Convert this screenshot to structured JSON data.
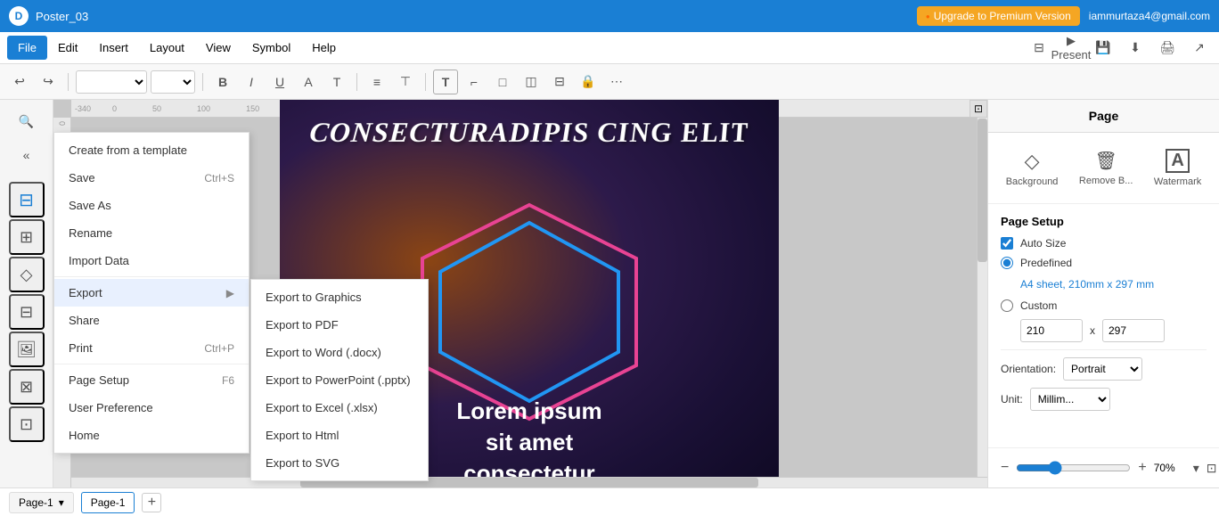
{
  "titleBar": {
    "appName": "Poster_03",
    "upgradeBtn": "Upgrade to Premium Version",
    "userEmail": "iammurtaza4@gmail.com"
  },
  "menuBar": {
    "items": [
      "File",
      "Edit",
      "Insert",
      "Layout",
      "View",
      "Symbol",
      "Help"
    ]
  },
  "toolbar": {
    "fontFamily": "",
    "fontSize": "",
    "bold": "B",
    "italic": "I",
    "underline": "U"
  },
  "fileMenu": {
    "items": [
      {
        "label": "Create from a template",
        "shortcut": "",
        "hasArrow": false
      },
      {
        "label": "Save",
        "shortcut": "Ctrl+S",
        "hasArrow": false
      },
      {
        "label": "Save As",
        "shortcut": "",
        "hasArrow": false
      },
      {
        "label": "Rename",
        "shortcut": "",
        "hasArrow": false
      },
      {
        "label": "Import Data",
        "shortcut": "",
        "hasArrow": false
      },
      {
        "label": "Export",
        "shortcut": "",
        "hasArrow": true
      },
      {
        "label": "Share",
        "shortcut": "",
        "hasArrow": false
      },
      {
        "label": "Print",
        "shortcut": "Ctrl+P",
        "hasArrow": false
      },
      {
        "label": "Page Setup",
        "shortcut": "F6",
        "hasArrow": false
      },
      {
        "label": "User Preference",
        "shortcut": "",
        "hasArrow": false
      },
      {
        "label": "Home",
        "shortcut": "",
        "hasArrow": false
      }
    ]
  },
  "exportSubmenu": {
    "items": [
      "Export to Graphics",
      "Export to PDF",
      "Export to Word (.docx)",
      "Export to PowerPoint (.pptx)",
      "Export to Excel (.xlsx)",
      "Export to Html",
      "Export to SVG"
    ]
  },
  "poster": {
    "textTop": "CONSECTURADIPIS CING ELIT",
    "textBottom": "Lorem ipsum\nsit amet\nconsectetur"
  },
  "rightPanel": {
    "title": "Page",
    "icons": [
      {
        "label": "Background",
        "glyph": "◇"
      },
      {
        "label": "Remove B...",
        "glyph": "🗑"
      },
      {
        "label": "Watermark",
        "glyph": "A"
      }
    ],
    "pageSetup": {
      "title": "Page Setup",
      "autoSize": "Auto Size",
      "predefined": "Predefined",
      "paperSize": "A4 sheet, 210mm x 297 mm",
      "custom": "Custom",
      "width": "210",
      "height": "297",
      "orientationLabel": "Orientation:",
      "orientationValue": "Portrait",
      "unitLabel": "Unit:",
      "unitValue": "Millim..."
    }
  },
  "bottomBar": {
    "pageLabel": "Page-1",
    "pageTab": "Page-1",
    "addBtn": "+"
  },
  "zoom": {
    "zoomLevel": "70%"
  },
  "sidebarIcons": [
    {
      "name": "layers-icon",
      "glyph": "❑"
    },
    {
      "name": "page-icon",
      "glyph": "⊞"
    },
    {
      "name": "shape-icon",
      "glyph": "◇"
    },
    {
      "name": "image-icon",
      "glyph": "⊟"
    },
    {
      "name": "text-icon",
      "glyph": "≡"
    },
    {
      "name": "link-icon",
      "glyph": "⊠"
    },
    {
      "name": "group-icon",
      "glyph": "⊡"
    }
  ]
}
